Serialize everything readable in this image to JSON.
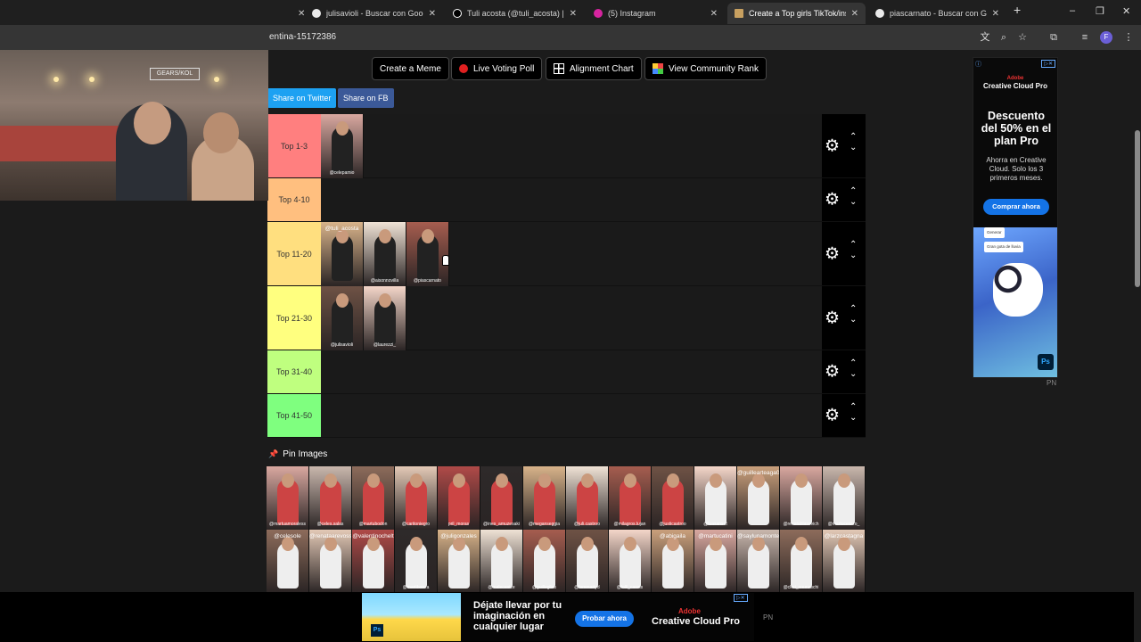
{
  "browser": {
    "tabs": [
      {
        "title": "julisavioli - Buscar con Google",
        "icon": "google-icon"
      },
      {
        "title": "Tuli acosta (@tuli_acosta) | TikT",
        "icon": "tiktok-icon"
      },
      {
        "title": "(5) Instagram",
        "icon": "instagram-icon"
      },
      {
        "title": "Create a Top girls TikTok/insta",
        "icon": "tiermaker-icon",
        "active": true
      },
      {
        "title": "piascarnato - Buscar con Goog",
        "icon": "google-icon"
      }
    ],
    "new_tab": "+",
    "url": "entina-15172386",
    "window_controls": [
      "–",
      "❐",
      "✕"
    ]
  },
  "webcam": {
    "sign_text": "GEARS/KOL"
  },
  "toolbar": {
    "meme": "Create a Meme",
    "poll": "Live Voting Poll",
    "alignment": "Alignment Chart",
    "community": "View Community Rank",
    "share_twitter": "Share on Twitter",
    "share_fb": "Share on FB"
  },
  "tiers": [
    {
      "label": "Top 1-3",
      "color": "#ff7f7f",
      "items": [
        {
          "handle": "@celepamio",
          "top": ""
        }
      ]
    },
    {
      "label": "Top 4-10",
      "color": "#ffbf7f",
      "items": []
    },
    {
      "label": "Top 11-20",
      "color": "#ffdf7f",
      "items": [
        {
          "handle": "",
          "top": "@tuli_acosta"
        },
        {
          "handle": "@aisonnovilla",
          "top": ""
        },
        {
          "handle": "@piascarnato",
          "top": ""
        }
      ]
    },
    {
      "label": "Top 21-30",
      "color": "#ffff7f",
      "items": [
        {
          "handle": "@julisavioli",
          "top": ""
        },
        {
          "handle": "@laurezzi_",
          "top": ""
        }
      ]
    },
    {
      "label": "Top 31-40",
      "color": "#bfff7f",
      "items": []
    },
    {
      "label": "Top 41-50",
      "color": "#7fff7f",
      "items": []
    }
  ],
  "pin_section": {
    "title": "Pin Images"
  },
  "pool": [
    {
      "handle": "@martuamoraless",
      "top": ""
    },
    {
      "handle": "@celes.salas",
      "top": ""
    },
    {
      "handle": "@martubodon",
      "top": ""
    },
    {
      "handle": "@caritoniegro",
      "top": ""
    },
    {
      "handle": "pril_moras",
      "top": ""
    },
    {
      "handle": "@ines_amuzesaki",
      "top": ""
    },
    {
      "handle": "@meganseggia",
      "top": ""
    },
    {
      "handle": "@juli.castroo",
      "top": ""
    },
    {
      "handle": "@milagros.lujan",
      "top": ""
    },
    {
      "handle": "@justicastroo",
      "top": ""
    },
    {
      "handle": "@luasansat",
      "top": ""
    },
    {
      "handle": "",
      "top": "@guillearteaga01"
    },
    {
      "handle": "@renatablasevich",
      "top": ""
    },
    {
      "handle": "@martucerezo_",
      "top": ""
    },
    {
      "handle": "",
      "top": "@celesole"
    },
    {
      "handle": "",
      "top": "@renataarevosso"
    },
    {
      "handle": "",
      "top": "@valentinochelt"
    },
    {
      "handle": "@martibonza",
      "top": ""
    },
    {
      "handle": "",
      "top": "@juligonzales"
    },
    {
      "handle": "@malecenize",
      "top": ""
    },
    {
      "handle": "@guilleglias",
      "top": ""
    },
    {
      "handle": "@lommartyd",
      "top": ""
    },
    {
      "handle": "@lolli_casals",
      "top": ""
    },
    {
      "handle": "",
      "top": "@abigaila"
    },
    {
      "handle": "",
      "top": "@martucatini"
    },
    {
      "handle": "",
      "top": "@saylunamontes"
    },
    {
      "handle": "@cleri_cremaschi",
      "top": ""
    },
    {
      "handle": "",
      "top": "@larzcastagna"
    }
  ],
  "ad_right": {
    "adobe": "Adobe",
    "brand": "Creative Cloud Pro",
    "headline": "Descuento del 50% en el plan Pro",
    "body": "Ahorra en Creative Cloud. Solo los 3 primeros meses.",
    "cta": "Comprar ahora",
    "chip1": "Generar",
    "chip2": "Gran gota de lluvia",
    "ps": "Ps",
    "pn": "PN"
  },
  "ad_bottom": {
    "text": "Déjate llevar por tu imaginación en cualquier lugar",
    "cta": "Probar ahora",
    "adobe": "Adobe",
    "brand": "Creative Cloud Pro",
    "pn": "PN",
    "ps": "Ps"
  },
  "colors": {
    "twitter": "#1da1f2",
    "facebook": "#3b5998",
    "cta_blue": "#1473e6"
  }
}
